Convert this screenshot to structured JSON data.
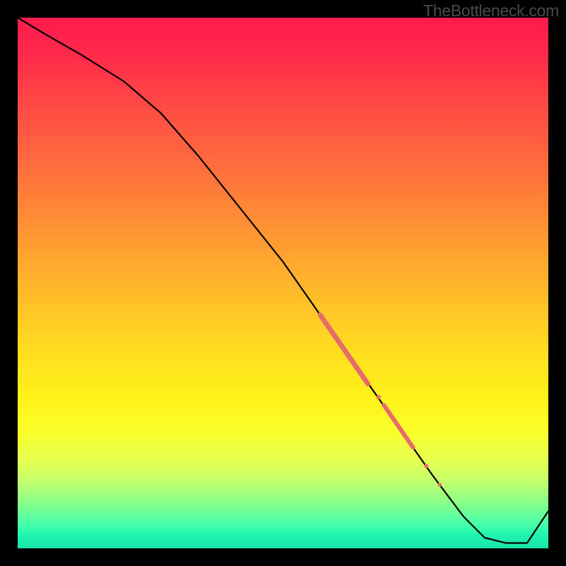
{
  "watermark": "TheBottleneck.com",
  "chart_data": {
    "type": "line",
    "title": "",
    "xlabel": "",
    "ylabel": "",
    "xlim": [
      0,
      100
    ],
    "ylim": [
      0,
      100
    ],
    "series": [
      {
        "name": "main-curve",
        "x": [
          0,
          5,
          12,
          20,
          27,
          34,
          42,
          50,
          57,
          64,
          71,
          78,
          84,
          88,
          92,
          96,
          100
        ],
        "y": [
          100,
          97,
          93,
          88,
          82,
          74,
          64,
          54,
          44,
          34,
          24,
          14,
          6,
          2,
          1,
          1,
          7
        ]
      }
    ],
    "highlights": [
      {
        "type": "segment",
        "x0": 57,
        "y0": 44,
        "x1": 66,
        "y1": 31,
        "width": 7
      },
      {
        "type": "dot",
        "x": 68,
        "y": 28.5,
        "r": 3.2
      },
      {
        "type": "segment",
        "x0": 69,
        "y0": 27,
        "x1": 74.5,
        "y1": 19,
        "width": 6
      },
      {
        "type": "dot",
        "x": 77,
        "y": 15.5,
        "r": 3.0
      },
      {
        "type": "dot",
        "x": 79.5,
        "y": 12,
        "r": 2.8
      }
    ],
    "highlight_color": "#e86b6b"
  }
}
